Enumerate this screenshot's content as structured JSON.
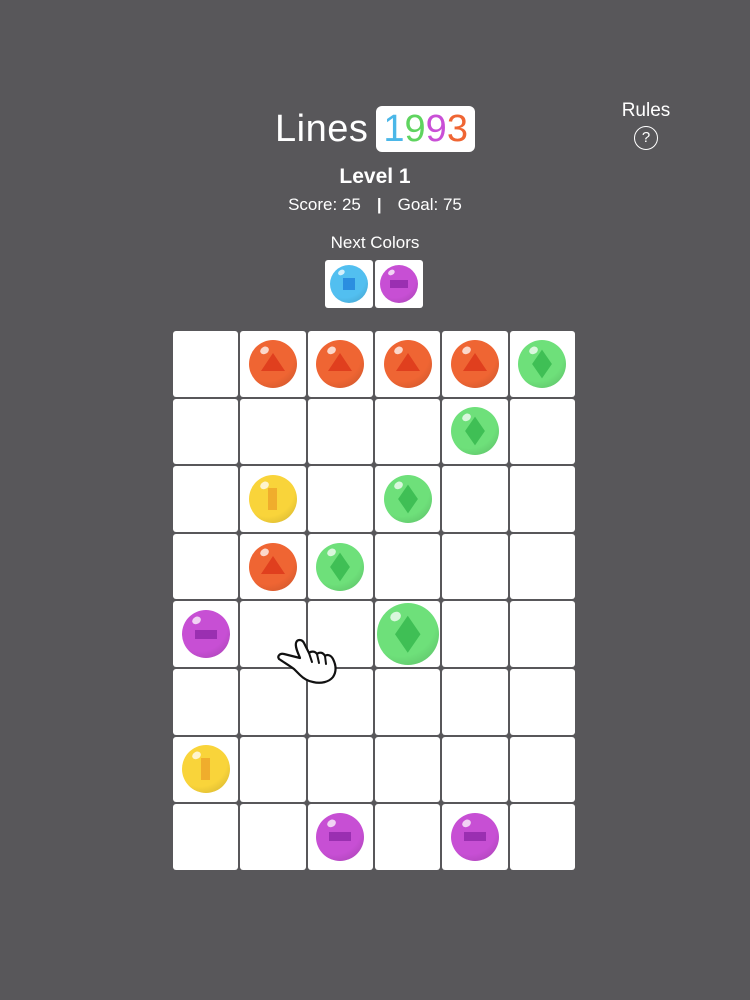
{
  "header": {
    "title_word": "Lines",
    "title_year_digits": [
      {
        "char": "1",
        "color": "#4bb7e8"
      },
      {
        "char": "9",
        "color": "#5fd45f"
      },
      {
        "char": "9",
        "color": "#c94fd6"
      },
      {
        "char": "3",
        "color": "#ef6533"
      }
    ],
    "rules_label": "Rules",
    "rules_icon_glyph": "?"
  },
  "status": {
    "level_label": "Level 1",
    "score_text": "Score: 25",
    "separator": "|",
    "goal_text": "Goal: 75"
  },
  "next": {
    "label": "Next Colors",
    "balls": [
      "blue",
      "purple"
    ]
  },
  "colors": {
    "red": {
      "fill": "#ef6533",
      "shape": "#e03f1e",
      "symbol": "triangle"
    },
    "green": {
      "fill": "#6ee07a",
      "shape": "#3fbf55",
      "symbol": "diamond"
    },
    "yellow": {
      "fill": "#f9d43a",
      "shape": "#f0ad2c",
      "symbol": "bar"
    },
    "purple": {
      "fill": "#c74fd4",
      "shape": "#9a2fb1",
      "symbol": "minus"
    },
    "blue": {
      "fill": "#52bff0",
      "shape": "#2b8ee0",
      "symbol": "square"
    }
  },
  "board": {
    "rows": 8,
    "cols": 6,
    "grid": [
      [
        "",
        "red",
        "red",
        "red",
        "red",
        "green"
      ],
      [
        "",
        "",
        "",
        "",
        "green",
        ""
      ],
      [
        "",
        "yellow",
        "",
        "green",
        "",
        ""
      ],
      [
        "",
        "red",
        "green",
        "",
        "",
        ""
      ],
      [
        "purple",
        "",
        "",
        "green",
        "",
        ""
      ],
      [
        "",
        "",
        "",
        "",
        "",
        ""
      ],
      [
        "yellow",
        "",
        "",
        "",
        "",
        ""
      ],
      [
        "",
        "",
        "purple",
        "",
        "purple",
        ""
      ]
    ],
    "selected": {
      "row": 4,
      "col": 3
    }
  },
  "tutorial_hand_icon": "pointing-hand-icon"
}
